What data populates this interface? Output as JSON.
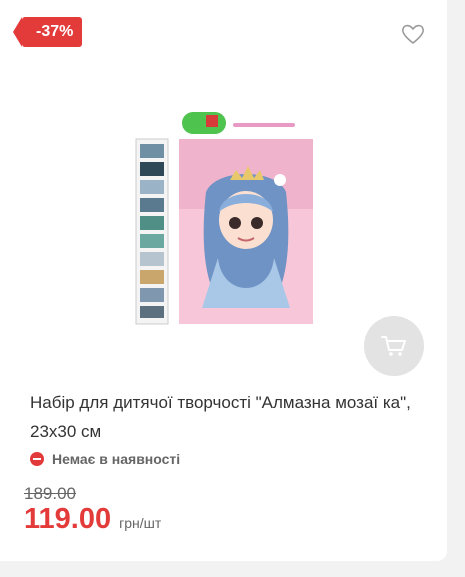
{
  "product": {
    "discount_badge": "-37%",
    "title": "Набір для дитячої творчості \"Алмазна мозаї ка\", 23х30 см",
    "stock_status": "Немає в наявності",
    "old_price": "189.00",
    "price": "119.00",
    "unit": "грн/шт"
  },
  "icons": {
    "favorite": "heart-icon",
    "cart": "cart-icon",
    "stock": "minus-circle-icon"
  },
  "colors": {
    "accent": "#e33a3a",
    "cart_button_bg": "#e3e3e3"
  }
}
